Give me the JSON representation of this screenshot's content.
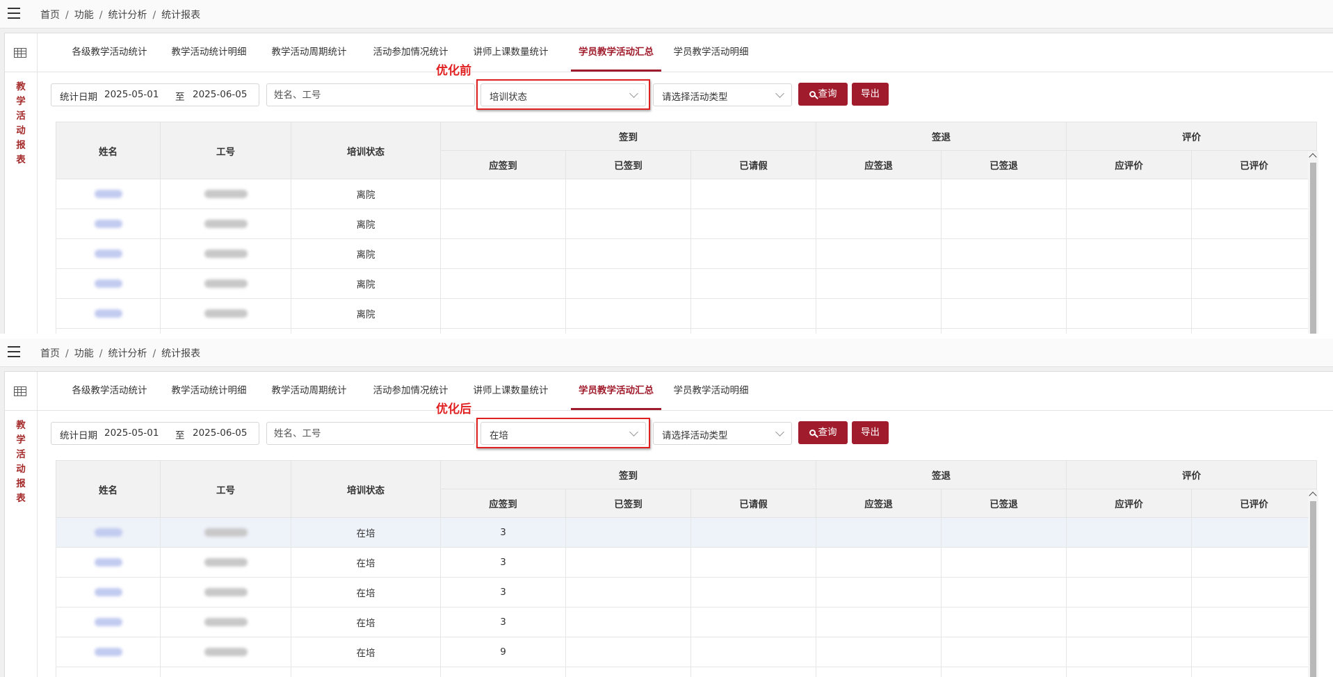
{
  "panels": [
    {
      "breadcrumb": [
        "首页",
        "功能",
        "统计分析",
        "统计报表"
      ],
      "sidebar_title": "教学活动报表",
      "tabs": [
        "各级教学活动统计",
        "教学活动统计明细",
        "教学活动周期统计",
        "活动参加情况统计",
        "讲师上课数量统计",
        "学员教学活动汇总",
        "学员教学活动明细"
      ],
      "active_tab_index": 5,
      "filters": {
        "date_label": "统计日期",
        "date_from": "2025-05-01",
        "date_to_sep": "至",
        "date_to": "2025-06-05",
        "search_placeholder": "姓名、工号",
        "status_value": "培训状态",
        "activity_type_placeholder": "请选择活动类型",
        "query_label": "查询",
        "export_label": "导出"
      },
      "annotation": "优化前",
      "table": {
        "headers": {
          "name": "姓名",
          "id": "工号",
          "status": "培训状态",
          "signin": "签到",
          "signout": "签退",
          "eval": "评价"
        },
        "subheaders": [
          "应签到",
          "已签到",
          "已请假",
          "应签退",
          "已签退",
          "应评价",
          "已评价"
        ],
        "rows": [
          {
            "status": "离院",
            "should_signin": ""
          },
          {
            "status": "离院",
            "should_signin": ""
          },
          {
            "status": "离院",
            "should_signin": ""
          },
          {
            "status": "离院",
            "should_signin": ""
          },
          {
            "status": "离院",
            "should_signin": ""
          },
          {
            "status": "",
            "should_signin": ""
          }
        ]
      }
    },
    {
      "breadcrumb": [
        "首页",
        "功能",
        "统计分析",
        "统计报表"
      ],
      "sidebar_title": "教学活动报表",
      "tabs": [
        "各级教学活动统计",
        "教学活动统计明细",
        "教学活动周期统计",
        "活动参加情况统计",
        "讲师上课数量统计",
        "学员教学活动汇总",
        "学员教学活动明细"
      ],
      "active_tab_index": 5,
      "filters": {
        "date_label": "统计日期",
        "date_from": "2025-05-01",
        "date_to_sep": "至",
        "date_to": "2025-06-05",
        "search_placeholder": "姓名、工号",
        "status_value": "在培",
        "activity_type_placeholder": "请选择活动类型",
        "query_label": "查询",
        "export_label": "导出"
      },
      "annotation": "优化后",
      "table": {
        "headers": {
          "name": "姓名",
          "id": "工号",
          "status": "培训状态",
          "signin": "签到",
          "signout": "签退",
          "eval": "评价"
        },
        "subheaders": [
          "应签到",
          "已签到",
          "已请假",
          "应签退",
          "已签退",
          "应评价",
          "已评价"
        ],
        "rows": [
          {
            "status": "在培",
            "should_signin": "3"
          },
          {
            "status": "在培",
            "should_signin": "3"
          },
          {
            "status": "在培",
            "should_signin": "3"
          },
          {
            "status": "在培",
            "should_signin": "3"
          },
          {
            "status": "在培",
            "should_signin": "9"
          },
          {
            "status": "",
            "should_signin": ""
          }
        ]
      }
    }
  ],
  "colors": {
    "accent": "#a01c2d",
    "highlight": "#e02020",
    "sidebar_title": "#a52a2a"
  },
  "icons": {
    "menu": "hamburger-icon",
    "grid": "table-grid-icon",
    "search": "search-icon",
    "dropdown": "chevron-down-icon"
  }
}
